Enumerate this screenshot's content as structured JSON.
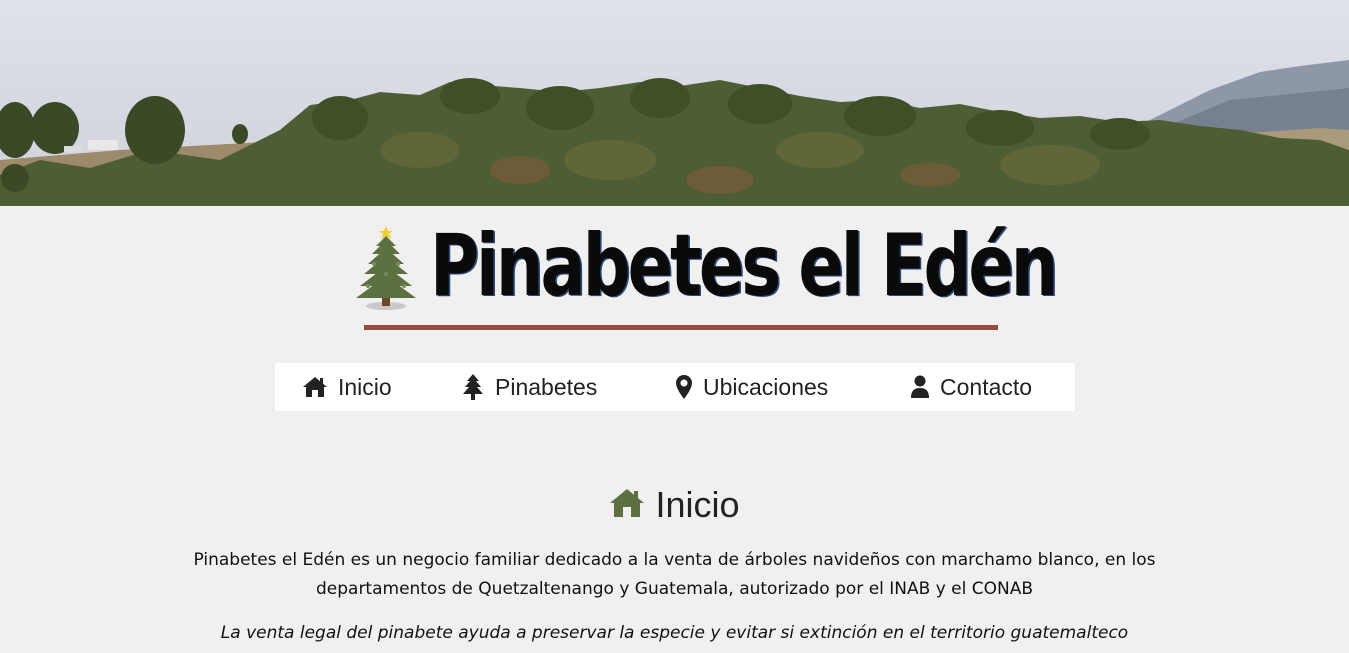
{
  "site": {
    "title": "Pinabetes el Edén",
    "logo_icon": "christmas-tree-icon"
  },
  "colors": {
    "accent_green": "#5d7040",
    "underline": "#9a4b40",
    "nav_bg": "#ffffff",
    "page_bg": "#f0f0f0"
  },
  "nav": {
    "items": [
      {
        "label": "Inicio",
        "icon": "home-icon"
      },
      {
        "label": "Pinabetes",
        "icon": "tree-icon"
      },
      {
        "label": "Ubicaciones",
        "icon": "map-marker-icon"
      },
      {
        "label": "Contacto",
        "icon": "user-icon"
      }
    ]
  },
  "main": {
    "heading": "Inicio",
    "heading_icon": "home-icon",
    "intro": "Pinabetes el Edén es un negocio familiar dedicado a la venta de árboles navideños con marchamo blanco, en los departamentos de Quetzaltenango y Guatemala, autorizado por el INAB y el CONAB",
    "tagline": "La venta legal del pinabete ayuda a preservar la especie y evitar si extinción en el territorio guatemalteco"
  }
}
